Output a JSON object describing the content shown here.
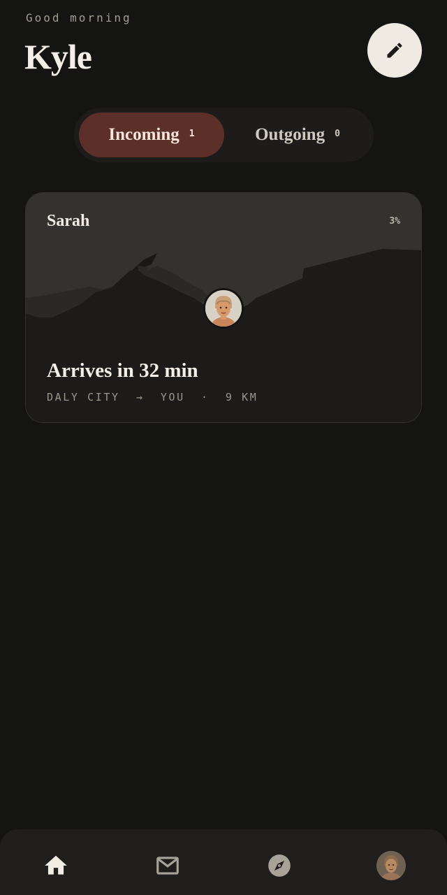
{
  "header": {
    "greeting": "Good morning",
    "user_name": "Kyle",
    "compose_icon": "pencil-icon"
  },
  "tabs": [
    {
      "label": "Incoming",
      "count": "1",
      "active": true
    },
    {
      "label": "Outgoing",
      "count": "0",
      "active": false
    }
  ],
  "deliveries": [
    {
      "sender": "Sarah",
      "progress": "3%",
      "progress_value": 0.03,
      "eta": "Arrives in 32 min",
      "route": "DALY CITY  →  YOU  ·  9 KM"
    }
  ],
  "nav": {
    "items": [
      "home-icon",
      "mail-icon",
      "compass-icon",
      "profile-avatar"
    ],
    "active": "home-icon"
  },
  "colors": {
    "background": "#141412",
    "accent_tab": "#5c3029",
    "card": "#1e1d1b",
    "compose_button": "#efebe3"
  }
}
